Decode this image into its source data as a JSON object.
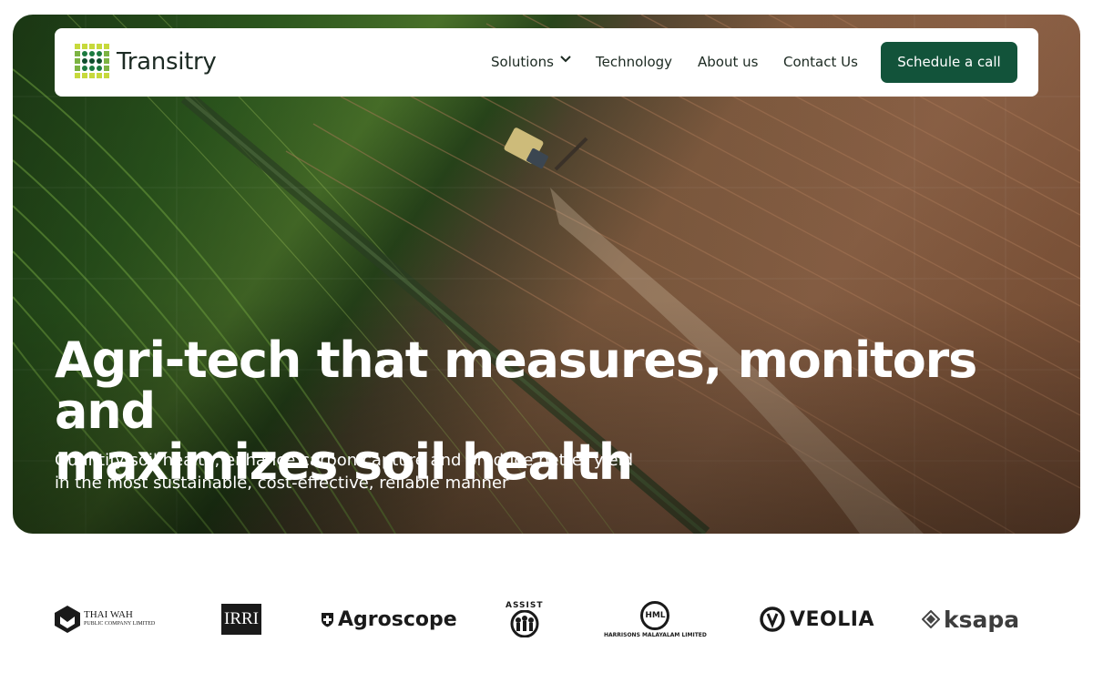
{
  "brand": {
    "name": "Transitry",
    "logo_icon": "dot-grid-logo-icon",
    "logo_colors": [
      "#c7d93c",
      "#7cb342",
      "#1b7a3f",
      "#0f4d2c"
    ]
  },
  "nav": {
    "items": [
      {
        "label": "Solutions",
        "icon": "chevron-down-icon"
      },
      {
        "label": "Technology"
      },
      {
        "label": "About us"
      },
      {
        "label": "Contact Us"
      }
    ],
    "cta_label": "Schedule a call",
    "cta_color": "#12533a"
  },
  "hero": {
    "headline_line1": "Agri-tech that measures, monitors and",
    "headline_line2": "maximizes soil health",
    "sub_line1": "Quantify soil health, enhance carbon capture and produce better yield",
    "sub_line2": "in the most sustainable, cost-effective, reliable manner"
  },
  "partners": [
    {
      "name": "THAI WAH",
      "subtitle": "PUBLIC COMPANY LIMITED"
    },
    {
      "name": "IRRI"
    },
    {
      "name": "Agroscope"
    },
    {
      "name": "ASSIST"
    },
    {
      "name": "HARRISONS MALAYALAM LIMITED",
      "mark": "HML"
    },
    {
      "name": "VEOLIA"
    },
    {
      "name": "ksapa"
    }
  ]
}
